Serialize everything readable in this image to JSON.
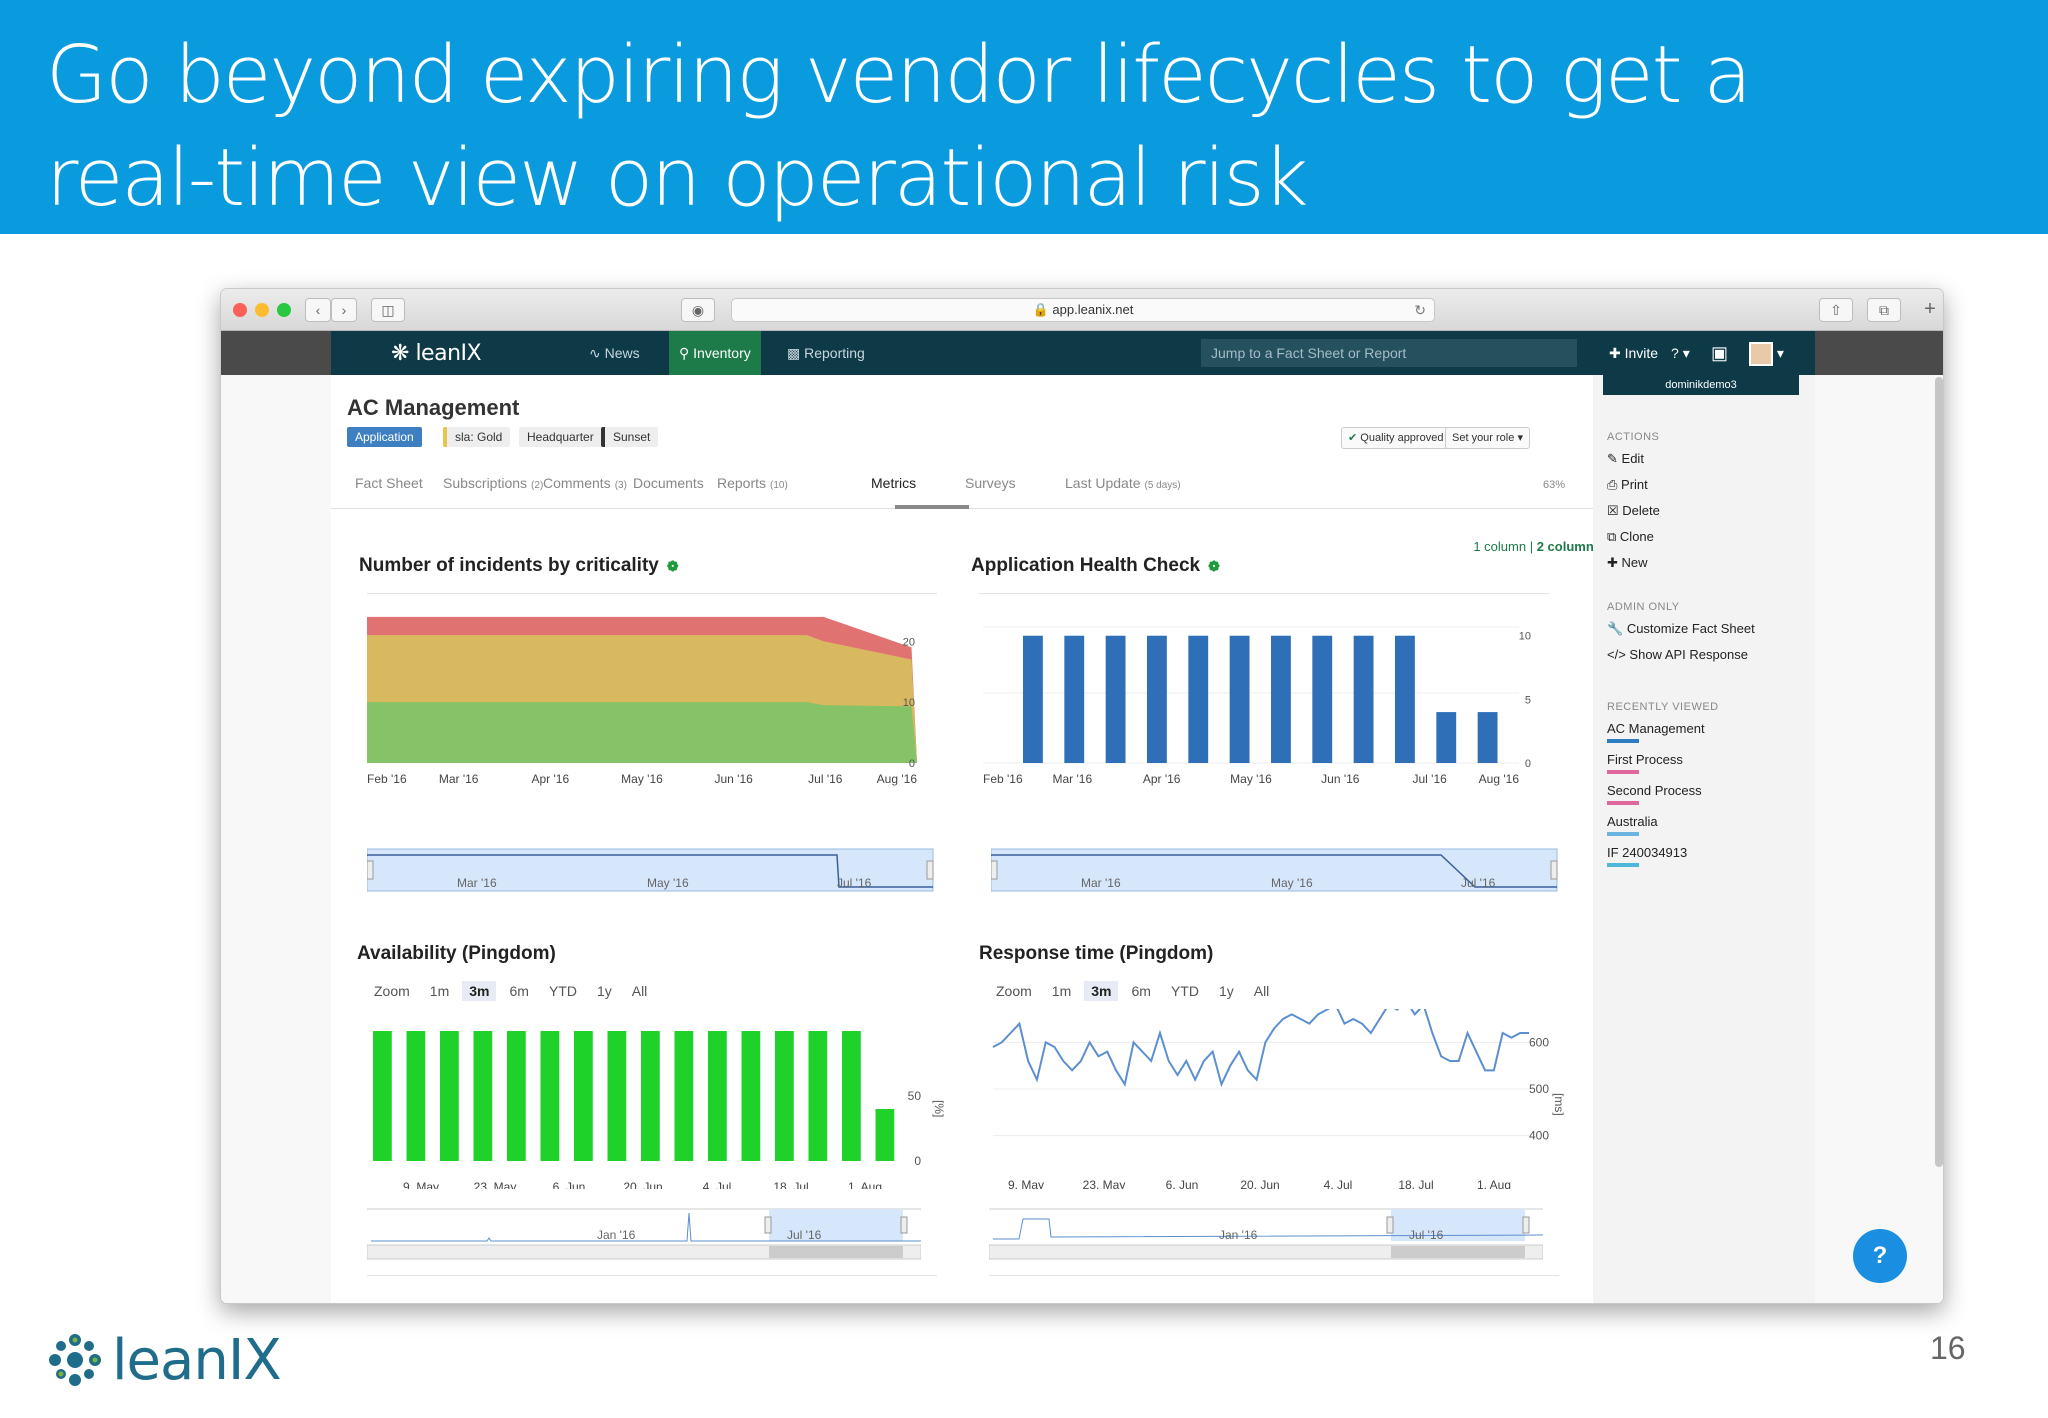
{
  "slide": {
    "title_line1": "Go beyond expiring vendor lifecycles to get a",
    "title_line2": "real-time view on operational risk",
    "logo_text": "leanIX",
    "page_number": "16"
  },
  "browser": {
    "url": "app.leanix.net"
  },
  "appbar": {
    "brand": "leanIX",
    "nav": [
      {
        "label": "News",
        "icon": "rss-icon"
      },
      {
        "label": "Inventory",
        "icon": "search-icon"
      },
      {
        "label": "Reporting",
        "icon": "bar-chart-icon"
      }
    ],
    "search_placeholder": "Jump to a Fact Sheet or Report",
    "invite": "Invite",
    "help": "?"
  },
  "factsheet": {
    "title": "AC Management",
    "tags": [
      "Application",
      "sla: Gold",
      "Headquarter",
      "Sunset"
    ],
    "quality_button": "Quality approved",
    "role_button": "Set your role",
    "tabs": [
      {
        "label": "Fact Sheet",
        "count": ""
      },
      {
        "label": "Subscriptions",
        "count": "(2)"
      },
      {
        "label": "Comments",
        "count": "(3)"
      },
      {
        "label": "Documents",
        "count": ""
      },
      {
        "label": "Reports",
        "count": "(10)"
      },
      {
        "label": "Metrics",
        "count": ""
      },
      {
        "label": "Surveys",
        "count": ""
      },
      {
        "label": "Last Update",
        "count": "(5 days)"
      }
    ],
    "completion": "63%",
    "column_toggle_1": "1 column",
    "column_toggle_sep": "|",
    "column_toggle_2": "2 columns"
  },
  "sidebar": {
    "user": "dominikdemo3",
    "actions_header": "ACTIONS",
    "actions": [
      "Edit",
      "Print",
      "Delete",
      "Clone",
      "New"
    ],
    "admin_header": "ADMIN ONLY",
    "admin": [
      "Customize Fact Sheet",
      "Show API Response"
    ],
    "recent_header": "RECENTLY VIEWED",
    "recent": [
      {
        "label": "AC Management",
        "color": "#2b7cc0"
      },
      {
        "label": "First Process",
        "color": "#e0679b"
      },
      {
        "label": "Second Process",
        "color": "#e0679b"
      },
      {
        "label": "Australia",
        "color": "#6cb4e0"
      },
      {
        "label": "IF 240034913",
        "color": "#4fb8d8"
      }
    ]
  },
  "zoom_buttons": [
    "Zoom",
    "1m",
    "3m",
    "6m",
    "YTD",
    "1y",
    "All"
  ],
  "chart_data": [
    {
      "type": "area",
      "title": "Number of incidents by criticality",
      "categories": [
        "Feb '16",
        "Mar '16",
        "Apr '16",
        "May '16",
        "Jun '16",
        "Jul '16",
        "Aug '16"
      ],
      "y_ticks": [
        "20",
        "10",
        "0"
      ],
      "ylim": [
        0,
        23
      ],
      "series": [
        {
          "color": "#86c267",
          "values": [
            10,
            10,
            10,
            10,
            10,
            9.5,
            9.3,
            0
          ]
        },
        {
          "color": "#d8b95f",
          "values": [
            21,
            21,
            21,
            21,
            21,
            20,
            17,
            0
          ]
        },
        {
          "color": "#e07272",
          "values": [
            24,
            24,
            24,
            24,
            24,
            24,
            19,
            0
          ]
        }
      ],
      "navigator_labels": [
        "Mar '16",
        "May '16",
        "Jul '16"
      ]
    },
    {
      "type": "bar",
      "title": "Application Health Check",
      "categories": [
        "Feb '16",
        "Mar '16",
        "Apr '16",
        "May '16",
        "Jun '16",
        "Jul '16",
        "Aug '16"
      ],
      "y_ticks": [
        "10",
        "5",
        "0"
      ],
      "ylim": [
        0,
        11
      ],
      "values": [
        10,
        10,
        10,
        10,
        10,
        10,
        10,
        10,
        10,
        10,
        4,
        4
      ],
      "color": "#2e6fb7",
      "navigator_labels": [
        "Mar '16",
        "May '16",
        "Jul '16"
      ]
    },
    {
      "type": "bar",
      "title": "Availability (Pingdom)",
      "categories": [
        "9. May",
        "23. May",
        "6. Jun",
        "20. Jun",
        "4. Jul",
        "18. Jul",
        "1. Aug"
      ],
      "y_ticks": [
        "50",
        "0"
      ],
      "y_unit": "[%]",
      "ylim": [
        0,
        100
      ],
      "values": [
        100,
        100,
        100,
        100,
        100,
        100,
        100,
        100,
        100,
        100,
        100,
        100,
        100,
        100,
        100,
        40
      ],
      "color": "#1fd22a",
      "navigator_labels": [
        "Jan '16",
        "Jul '16"
      ]
    },
    {
      "type": "line",
      "title": "Response time (Pingdom)",
      "categories": [
        "9. May",
        "23. May",
        "6. Jun",
        "20. Jun",
        "4. Jul",
        "18. Jul",
        "1. Aug"
      ],
      "y_ticks": [
        "600",
        "500",
        "400"
      ],
      "y_unit": "[ms]",
      "ylim": [
        350,
        650
      ],
      "values": [
        590,
        600,
        620,
        640,
        560,
        520,
        600,
        590,
        560,
        540,
        560,
        600,
        570,
        580,
        540,
        510,
        600,
        580,
        560,
        620,
        560,
        530,
        560,
        520,
        560,
        580,
        510,
        550,
        580,
        540,
        520,
        600,
        630,
        650,
        660,
        650,
        640,
        660,
        670,
        680,
        640,
        650,
        640,
        620,
        650,
        680,
        670,
        690,
        660,
        680,
        620,
        570,
        560,
        560,
        620,
        580,
        540,
        540,
        620,
        610,
        620,
        620
      ],
      "color": "#5b8fcf",
      "navigator_labels": [
        "Jan '16",
        "Jul '16"
      ]
    }
  ]
}
